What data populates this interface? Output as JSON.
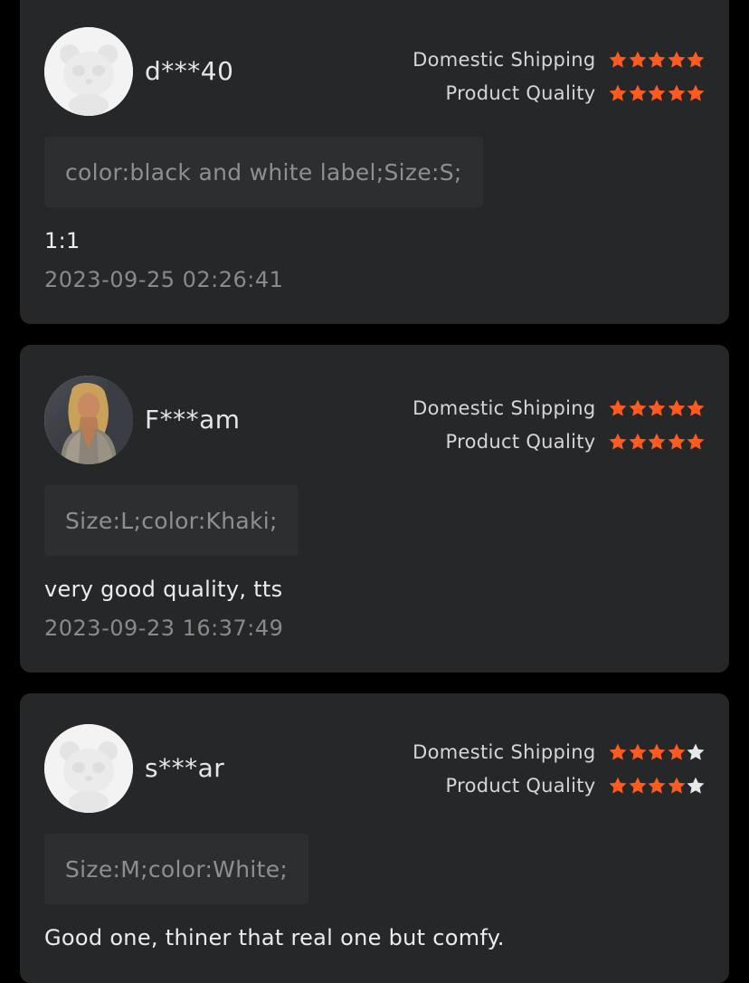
{
  "colors": {
    "page_bg": "#000000",
    "card_bg": "#262729",
    "star_filled": "#ff5a1f",
    "star_empty": "#e8e8e8"
  },
  "reviews": [
    {
      "username": "d***40",
      "avatar": "panda-avatar-icon",
      "ratings": [
        {
          "label": "Domestic Shipping",
          "stars": 5,
          "max": 5
        },
        {
          "label": "Product Quality",
          "stars": 5,
          "max": 5
        }
      ],
      "variant": "color:black and white label;Size:S;",
      "comment": "1:1",
      "date": "2023-09-25 02:26:41"
    },
    {
      "username": "F***am",
      "avatar": "user-photo-avatar",
      "ratings": [
        {
          "label": "Domestic Shipping",
          "stars": 5,
          "max": 5
        },
        {
          "label": "Product Quality",
          "stars": 5,
          "max": 5
        }
      ],
      "variant": "Size:L;color:Khaki;",
      "comment": "very good quality, tts",
      "date": "2023-09-23 16:37:49"
    },
    {
      "username": "s***ar",
      "avatar": "panda-avatar-icon",
      "ratings": [
        {
          "label": "Domestic Shipping",
          "stars": 4,
          "max": 5
        },
        {
          "label": "Product Quality",
          "stars": 4,
          "max": 5
        }
      ],
      "variant": "Size:M;color:White;",
      "comment": "Good one, thiner that real one but comfy.",
      "date": ""
    }
  ]
}
